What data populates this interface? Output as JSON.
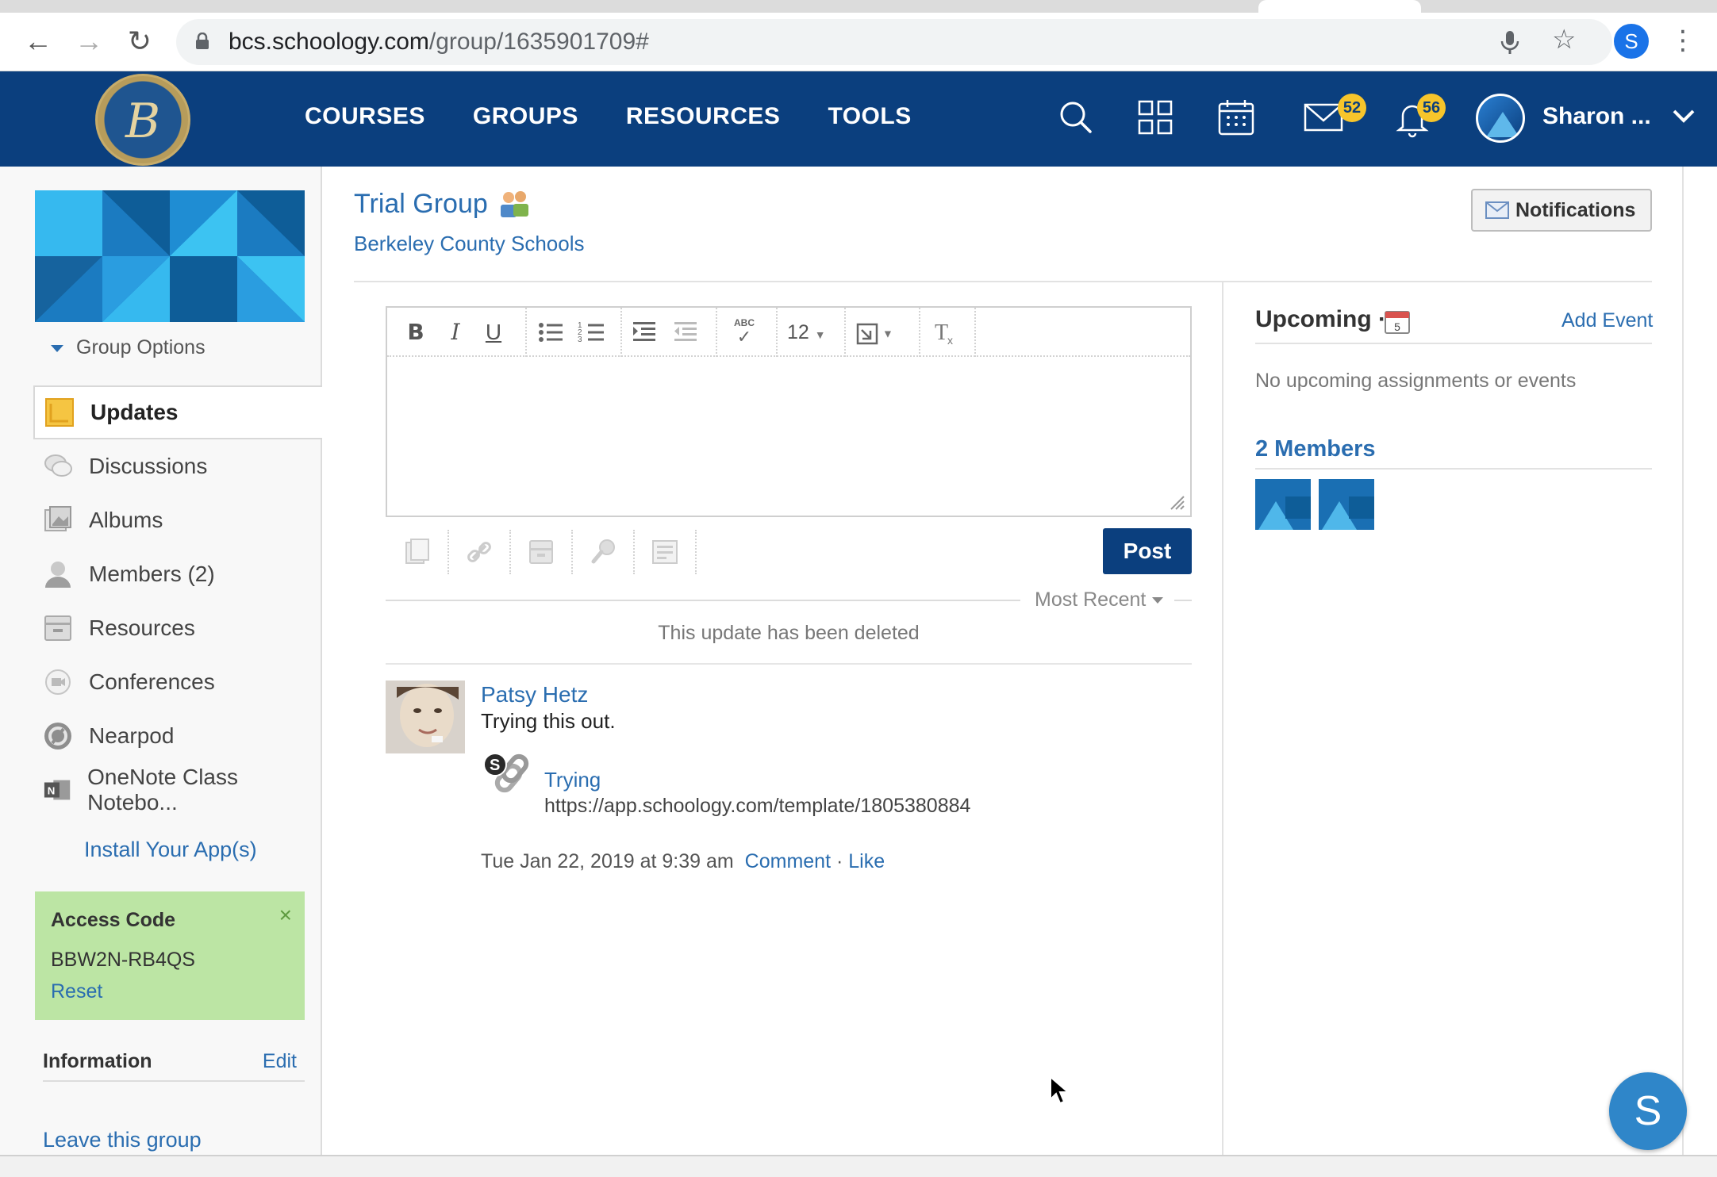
{
  "browser": {
    "url_host": "bcs.schoology.com",
    "url_path": "/group/1635901709#",
    "profile_initial": "S"
  },
  "header": {
    "logo_letter": "B",
    "nav": [
      "COURSES",
      "GROUPS",
      "RESOURCES",
      "TOOLS"
    ],
    "messages_count": "52",
    "notifications_count": "56",
    "user_name": "Sharon ..."
  },
  "sidebar": {
    "group_options": "Group Options",
    "items": [
      {
        "label": "Updates",
        "icon": "updates-icon"
      },
      {
        "label": "Discussions",
        "icon": "discussions-icon"
      },
      {
        "label": "Albums",
        "icon": "albums-icon"
      },
      {
        "label": "Members (2)",
        "icon": "members-icon"
      },
      {
        "label": "Resources",
        "icon": "resources-icon"
      },
      {
        "label": "Conferences",
        "icon": "conferences-icon"
      },
      {
        "label": "Nearpod",
        "icon": "nearpod-icon"
      },
      {
        "label": "OneNote Class Notebo...",
        "icon": "onenote-icon"
      }
    ],
    "install_apps": "Install Your App(s)",
    "access_code": {
      "title": "Access Code",
      "close": "×",
      "code": "BBW2N-RB4QS",
      "reset": "Reset"
    },
    "information": {
      "title": "Information",
      "edit": "Edit"
    },
    "leave": "Leave this group"
  },
  "main": {
    "title": "Trial Group",
    "subtitle": "Berkeley County Schools",
    "notifications_button": "Notifications",
    "editor": {
      "font_size": "12",
      "spellcheck_label": "ABC",
      "post_button": "Post"
    },
    "sort_label": "Most Recent",
    "deleted_notice": "This update has been deleted",
    "post": {
      "author": "Patsy Hetz",
      "text": "Trying this out.",
      "link_title": "Trying",
      "link_url": "https://app.schoology.com/template/1805380884",
      "timestamp": "Tue Jan 22, 2019 at 9:39 am",
      "comment": "Comment",
      "separator": "·",
      "like": "Like"
    }
  },
  "right": {
    "upcoming": "Upcoming ·",
    "calendar_day": "5",
    "add_event": "Add Event",
    "no_upcoming": "No upcoming assignments or events",
    "members_heading": "2 Members"
  },
  "help_fab": "S",
  "colors": {
    "header_blue": "#0b3f7e",
    "link_blue": "#2a6db0",
    "badge_yellow": "#f7c52b",
    "access_green": "#bce5a4"
  }
}
